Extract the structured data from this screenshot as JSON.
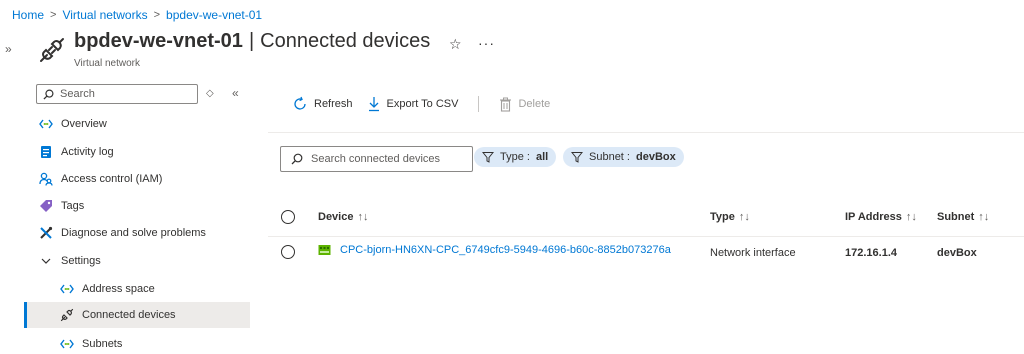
{
  "breadcrumb": [
    "Home",
    "Virtual networks",
    "bpdev-we-vnet-01"
  ],
  "collapse_rail": "»",
  "header": {
    "resource_name": "bpdev-we-vnet-01",
    "separator": "|",
    "page_name": "Connected devices",
    "subtitle": "Virtual network",
    "favorite_glyph": "☆",
    "more_glyph": "···"
  },
  "nav": {
    "search_placeholder": "Search",
    "sort_glyph": "◇",
    "collapse_glyph": "«",
    "items": [
      {
        "label": "Overview",
        "icon": "overview-icon"
      },
      {
        "label": "Activity log",
        "icon": "activity-log-icon"
      },
      {
        "label": "Access control (IAM)",
        "icon": "iam-icon"
      },
      {
        "label": "Tags",
        "icon": "tag-icon"
      },
      {
        "label": "Diagnose and solve problems",
        "icon": "diagnose-icon"
      },
      {
        "label": "Settings",
        "icon": "chevron-down-icon"
      },
      {
        "label": "Address space",
        "icon": "overview-icon"
      },
      {
        "label": "Connected devices",
        "icon": "plug-icon"
      },
      {
        "label": "Subnets",
        "icon": "overview-icon"
      }
    ]
  },
  "toolbar": {
    "refresh": "Refresh",
    "export": "Export To CSV",
    "delete": "Delete"
  },
  "filters": {
    "search_placeholder": "Search connected devices",
    "type_label": "Type :",
    "type_value": "all",
    "subnet_label": "Subnet :",
    "subnet_value": "devBox"
  },
  "table": {
    "columns": [
      "Device",
      "Type",
      "IP Address",
      "Subnet"
    ],
    "sort_glyph": "↑↓",
    "rows": [
      {
        "device": "CPC-bjorn-HN6XN-CPC_6749cfc9-5949-4696-b60c-8852b073276a",
        "type": "Network interface",
        "ip": "172.16.1.4",
        "subnet": "devBox"
      }
    ]
  },
  "colors": {
    "accent": "#0078d4",
    "pill_bg": "#dce9f7",
    "nav_selected_bg": "#edebe9",
    "nic_icon": "#5db300"
  }
}
